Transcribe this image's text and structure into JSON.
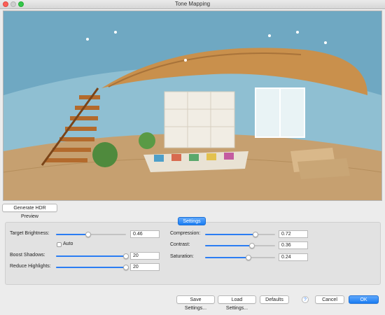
{
  "window": {
    "title": "Tone Mapping"
  },
  "preview_button": "Generate HDR Preview",
  "settings_tab": "Settings",
  "controls": {
    "target_brightness": {
      "label": "Target Brightness:",
      "value": "0.46",
      "level": 0.46
    },
    "auto": {
      "label": "Auto",
      "checked": false
    },
    "boost_shadows": {
      "label": "Boost Shadows:",
      "value": "20",
      "level": 1.0
    },
    "reduce_highlights": {
      "label": "Reduce Highlights:",
      "value": "20",
      "level": 1.0
    },
    "compression": {
      "label": "Compression:",
      "value": "0.72",
      "level": 0.72
    },
    "contrast": {
      "label": "Contrast:",
      "value": "0.36",
      "level": 0.67
    },
    "saturation": {
      "label": "Saturation:",
      "value": "0.24",
      "level": 0.62
    }
  },
  "footer": {
    "save": "Save Settings...",
    "load": "Load Settings...",
    "defaults": "Defaults",
    "help": "?",
    "cancel": "Cancel",
    "ok": "OK"
  },
  "colors": {
    "accent": "#2b7df3"
  }
}
